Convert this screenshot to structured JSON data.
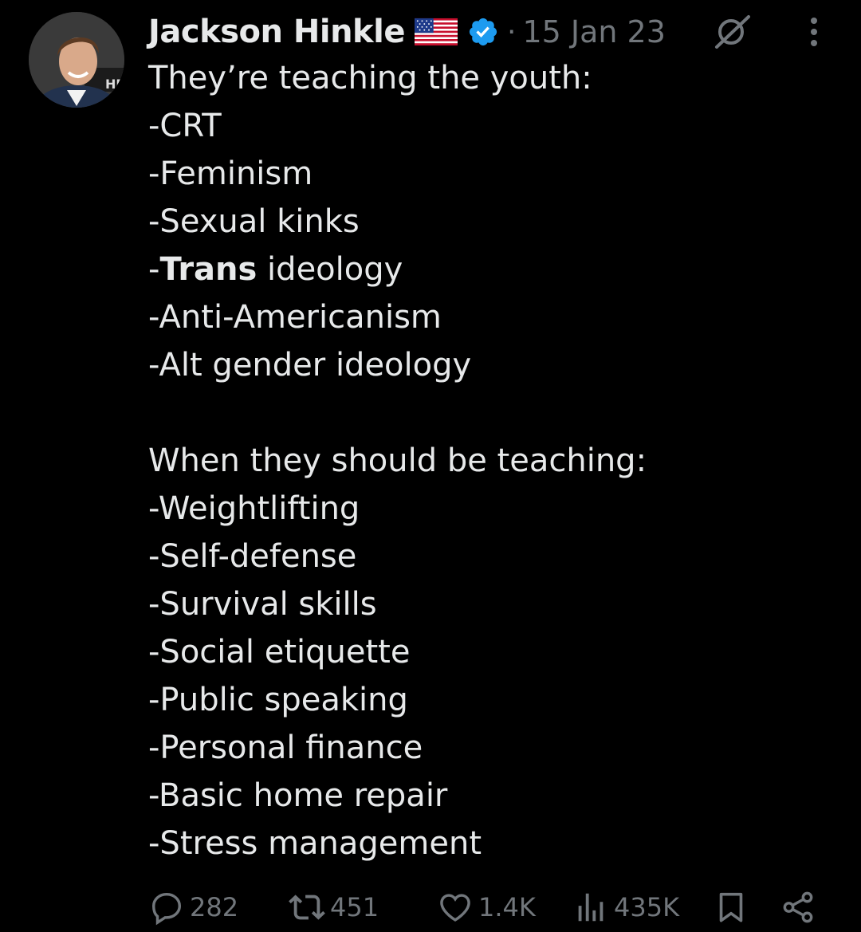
{
  "post": {
    "author": {
      "display_name": "Jackson Hinkle",
      "flag_emoji": "🇺🇸",
      "verified": true,
      "avatar_icon": "avatar-photo-icon"
    },
    "separator": "·",
    "timestamp": "15 Jan 23",
    "body": {
      "intro": "They’re teaching the youth:",
      "list1": [
        "-CRT",
        "-Feminism",
        "-Sexual kinks"
      ],
      "trans_prefix": "-",
      "trans_bold": "Trans",
      "trans_suffix": " ideology",
      "list1_rest": [
        "-Anti-Americanism",
        "-Alt gender ideology"
      ],
      "outro": "When they should be teaching:",
      "list2": [
        "-Weightlifting",
        "-Self-defense",
        "-Survival skills",
        "-Social etiquette",
        "-Public speaking",
        "-Personal finance",
        "-Basic home repair",
        "-Stress management"
      ]
    },
    "stats": {
      "replies": "282",
      "reposts": "451",
      "likes": "1.4K",
      "views": "435K"
    }
  },
  "colors": {
    "background": "#000000",
    "text": "#e7e9ea",
    "muted": "#71767b",
    "verified_blue": "#1d9bf0"
  }
}
